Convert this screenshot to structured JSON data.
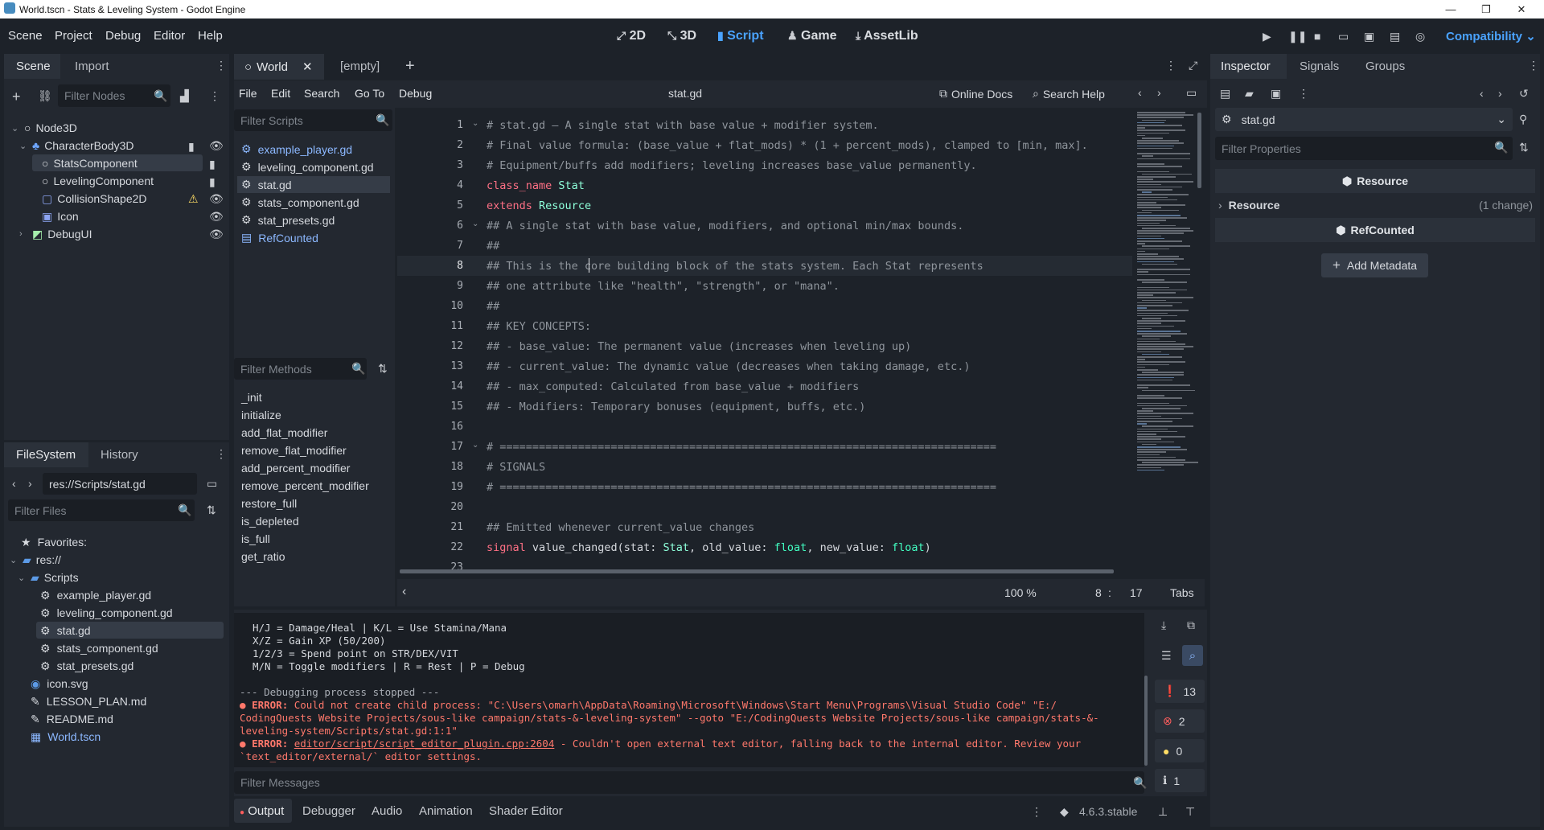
{
  "window": {
    "title": "World.tscn - Stats & Leveling System - Godot Engine"
  },
  "menu": [
    "Scene",
    "Project",
    "Debug",
    "Editor",
    "Help"
  ],
  "workspaces": [
    {
      "label": "2D",
      "icon": "2d-icon"
    },
    {
      "label": "3D",
      "icon": "3d-icon"
    },
    {
      "label": "Script",
      "icon": "script-icon",
      "active": true
    },
    {
      "label": "Game",
      "icon": "game-icon"
    },
    {
      "label": "AssetLib",
      "icon": "assetlib-icon"
    }
  ],
  "renderer": "Compatibility",
  "scene_dock": {
    "tabs": [
      "Scene",
      "Import"
    ],
    "filter_placeholder": "Filter Nodes",
    "tree": [
      {
        "label": "Node3D",
        "depth": 0
      },
      {
        "label": "CharacterBody3D",
        "depth": 1
      },
      {
        "label": "StatsComponent",
        "depth": 2,
        "selected": true
      },
      {
        "label": "LevelingComponent",
        "depth": 2
      },
      {
        "label": "CollisionShape2D",
        "depth": 2
      },
      {
        "label": "Icon",
        "depth": 2
      },
      {
        "label": "DebugUI",
        "depth": 1
      }
    ]
  },
  "filesystem": {
    "tabs": [
      "FileSystem",
      "History"
    ],
    "path": "res://Scripts/stat.gd",
    "filter_placeholder": "Filter Files",
    "favorites_label": "Favorites:",
    "root_label": "res://",
    "folder": "Scripts",
    "files": [
      "example_player.gd",
      "leveling_component.gd",
      "stat.gd",
      "stats_component.gd",
      "stat_presets.gd"
    ],
    "root_files": [
      "icon.svg",
      "LESSON_PLAN.md",
      "README.md",
      "World.tscn"
    ]
  },
  "editor_tabs": [
    {
      "label": "World"
    },
    {
      "label": "[empty]"
    }
  ],
  "script_menu": [
    "File",
    "Edit",
    "Search",
    "Go To",
    "Debug"
  ],
  "current_script": "stat.gd",
  "online_docs": "Online Docs",
  "search_help": "Search Help",
  "scripts_filter_placeholder": "Filter Scripts",
  "scripts": [
    "example_player.gd",
    "leveling_component.gd",
    "stat.gd",
    "stats_component.gd",
    "stat_presets.gd",
    "RefCounted"
  ],
  "methods_filter_placeholder": "Filter Methods",
  "methods": [
    "_init",
    "initialize",
    "add_flat_modifier",
    "remove_flat_modifier",
    "add_percent_modifier",
    "remove_percent_modifier",
    "restore_full",
    "is_depleted",
    "is_full",
    "get_ratio"
  ],
  "code": {
    "line_numbers": [
      "1",
      "2",
      "3",
      "4",
      "5",
      "6",
      "7",
      "8",
      "9",
      "10",
      "11",
      "12",
      "13",
      "14",
      "15",
      "16",
      "17",
      "18",
      "19",
      "20",
      "21",
      "22",
      "23"
    ],
    "l1": "# stat.gd — A single stat with base value + modifier system.",
    "l2": "# Final value formula: (base_value + flat_mods) * (1 + percent_mods), clamped to [min, max].",
    "l3": "# Equipment/buffs add modifiers; leveling increases base_value permanently.",
    "l4_kw": "class_name",
    "l4_id": "Stat",
    "l5_kw": "extends",
    "l5_id": "Resource",
    "l6": "## A single stat with base value, modifiers, and optional min/max bounds.",
    "l7": "##",
    "l8": "## This is the core building block of the stats system. Each Stat represents",
    "l9": "## one attribute like \"health\", \"strength\", or \"mana\".",
    "l10": "##",
    "l11": "## KEY CONCEPTS:",
    "l12": "## - base_value: The permanent value (increases when leveling up)",
    "l13": "## - current_value: The dynamic value (decreases when taking damage, etc.)",
    "l14": "## - max_computed: Calculated from base_value + modifiers",
    "l15": "## - Modifiers: Temporary bonuses (equipment, buffs, etc.)",
    "l17": "# ============================================================================",
    "l18": "# SIGNALS",
    "l19": "# ============================================================================",
    "l21": "## Emitted whenever current_value changes",
    "l22_kw": "signal",
    "l22_name": "value_changed(stat: ",
    "l22_t1": "Stat",
    "l22_mid": ", old_value: ",
    "l22_t2": "float",
    "l22_mid2": ", new_value: ",
    "l22_t3": "float",
    "l22_end": ")"
  },
  "status": {
    "zoom": "100 %",
    "line": "8",
    "col": "17",
    "indent": "Tabs"
  },
  "output": {
    "lines": [
      "H/J = Damage/Heal | K/L = Use Stamina/Mana",
      "X/Z = Gain XP (50/200)",
      "1/2/3 = Spend point on STR/DEX/VIT",
      "M/N = Toggle modifiers | R = Rest | P = Debug"
    ],
    "stopped": "--- Debugging process stopped ---",
    "error1_label": "ERROR:",
    "error1_a": "Could not create child process: \"C:\\Users\\omarh\\AppData\\Roaming\\Microsoft\\Windows\\Start Menu\\Programs\\Visual Studio Code\" \"E:/",
    "error1_b": "CodingQuests Website Projects/sous-like campaign/stats-&-leveling-system\" --goto \"E:/CodingQuests Website Projects/sous-like campaign/stats-&-",
    "error1_c": "leveling-system/Scripts/stat.gd:1:1\"",
    "error2_label": "ERROR:",
    "error2_link": "editor/script/script_editor_plugin.cpp:2604",
    "error2_a": " - Couldn't open external text editor, falling back to the internal editor. Review your",
    "error2_b": "`text_editor/external/` editor settings.",
    "filter_placeholder": "Filter Messages",
    "counts": {
      "all": "13",
      "errors": "2",
      "warnings": "0",
      "info": "1"
    }
  },
  "bottom_tabs": [
    "Output",
    "Debugger",
    "Audio",
    "Animation",
    "Shader Editor"
  ],
  "version": "4.6.3.stable",
  "inspector": {
    "tabs": [
      "Inspector",
      "Signals",
      "Groups"
    ],
    "resource_name": "stat.gd",
    "filter_placeholder": "Filter Properties",
    "section1": "Resource",
    "sub_label": "Resource",
    "sub_changes": "(1 change)",
    "section2": "RefCounted",
    "add_metadata": "Add Metadata"
  },
  "colors": {
    "accent": "#4aa3ff",
    "error": "#ff786b",
    "keyword": "#ff7085",
    "class": "#8effda"
  }
}
